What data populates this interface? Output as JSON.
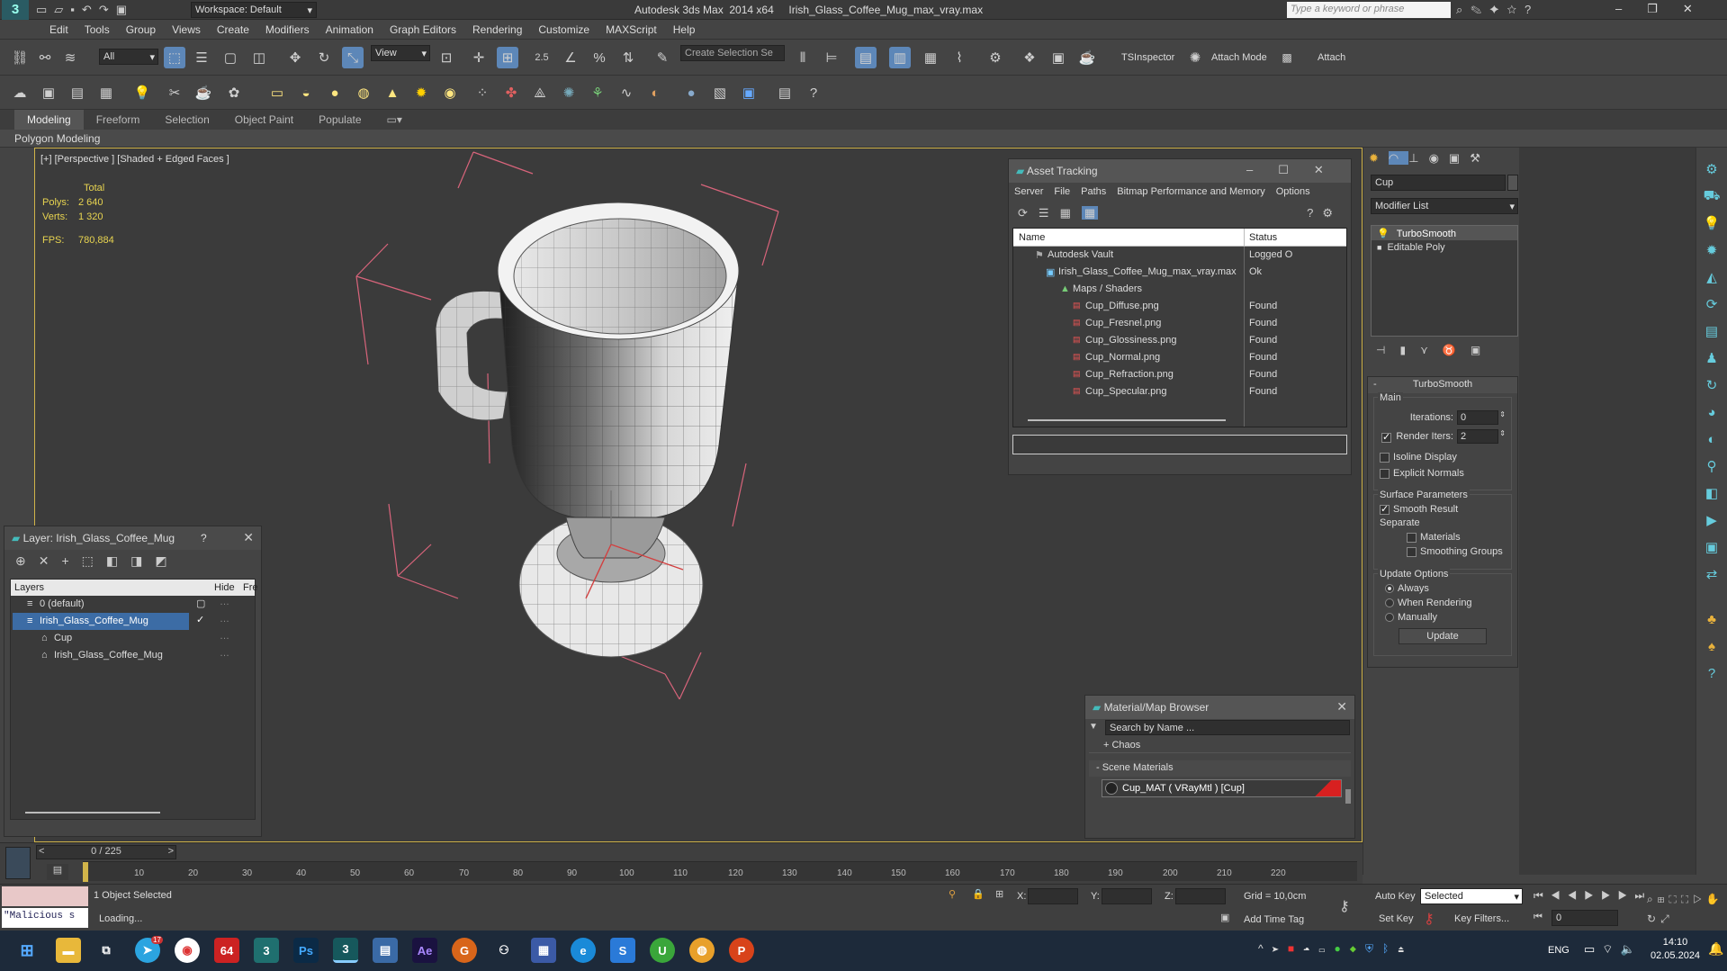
{
  "window": {
    "title": "Autodesk 3ds Max  2014 x64     Irish_Glass_Coffee_Mug_max_vray.max",
    "workspace": "Workspace: Default",
    "search_placeholder": "Type a keyword or phrase"
  },
  "menu": [
    "Edit",
    "Tools",
    "Group",
    "Views",
    "Create",
    "Modifiers",
    "Animation",
    "Graph Editors",
    "Rendering",
    "Customize",
    "MAXScript",
    "Help"
  ],
  "toolbar": {
    "filter_value": "All",
    "ref_coord": "View",
    "snap_label": "2.5",
    "selection_set_placeholder": "Create Selection Se",
    "tsinspector": "TSInspector",
    "attach_mode": "Attach Mode",
    "attach": "Attach"
  },
  "ribbon": {
    "tabs": [
      "Modeling",
      "Freeform",
      "Selection",
      "Object Paint",
      "Populate"
    ],
    "active": "Modeling",
    "sub": "Polygon Modeling"
  },
  "viewport": {
    "label": "[+] [Perspective ] [Shaded + Edged Faces ]",
    "stats_header": "Total",
    "polys_label": "Polys:",
    "polys_value": "2 640",
    "verts_label": "Verts:",
    "verts_value": "1 320",
    "fps_label": "FPS:",
    "fps_value": "780,884"
  },
  "layer_panel": {
    "title": "Layer: Irish_Glass_Coffee_Mug",
    "help": "?",
    "col_layers": "Layers",
    "col_hide": "Hide",
    "col_freeze": "Fre",
    "rows": [
      {
        "name": "0 (default)",
        "level": 1
      },
      {
        "name": "Irish_Glass_Coffee_Mug",
        "level": 1
      },
      {
        "name": "Cup",
        "level": 2
      },
      {
        "name": "Irish_Glass_Coffee_Mug",
        "level": 2
      }
    ]
  },
  "asset_tracking": {
    "title": "Asset Tracking",
    "menu": [
      "Server",
      "File",
      "Paths",
      "Bitmap Performance and Memory",
      "Options"
    ],
    "col_name": "Name",
    "col_status": "Status",
    "rows": [
      {
        "name": "Autodesk Vault",
        "status": "Logged O",
        "level": 1
      },
      {
        "name": "Irish_Glass_Coffee_Mug_max_vray.max",
        "status": "Ok",
        "level": 2
      },
      {
        "name": "Maps / Shaders",
        "status": "",
        "level": 3
      },
      {
        "name": "Cup_Diffuse.png",
        "status": "Found",
        "level": 4
      },
      {
        "name": "Cup_Fresnel.png",
        "status": "Found",
        "level": 4
      },
      {
        "name": "Cup_Glossiness.png",
        "status": "Found",
        "level": 4
      },
      {
        "name": "Cup_Normal.png",
        "status": "Found",
        "level": 4
      },
      {
        "name": "Cup_Refraction.png",
        "status": "Found",
        "level": 4
      },
      {
        "name": "Cup_Specular.png",
        "status": "Found",
        "level": 4
      }
    ]
  },
  "material_browser": {
    "title": "Material/Map Browser",
    "search_placeholder": "Search by Name ...",
    "group_chaos": "+ Chaos",
    "group_scene": "- Scene Materials",
    "material": "Cup_MAT  ( VRayMtl )  [Cup]"
  },
  "command_panel": {
    "object_name": "Cup",
    "modifier_list": "Modifier List",
    "stack": [
      "TurboSmooth",
      "Editable Poly"
    ],
    "rollout_title": "TurboSmooth",
    "main_label": "Main",
    "iterations_label": "Iterations:",
    "iterations_value": "0",
    "render_iters_label": "Render Iters:",
    "render_iters_value": "2",
    "isoline": "Isoline Display",
    "explicit_normals": "Explicit Normals",
    "surface_params": "Surface Parameters",
    "smooth_result": "Smooth Result",
    "separate": "Separate",
    "materials": "Materials",
    "smoothing_groups": "Smoothing Groups",
    "update_options": "Update Options",
    "always": "Always",
    "when_rendering": "When Rendering",
    "manually": "Manually",
    "update_btn": "Update"
  },
  "timeline": {
    "frame": "0 / 225",
    "ticks": [
      "10",
      "20",
      "30",
      "40",
      "50",
      "60",
      "70",
      "80",
      "90",
      "100",
      "110",
      "120",
      "130",
      "140",
      "150",
      "160",
      "170",
      "180",
      "190",
      "200",
      "210",
      "220"
    ]
  },
  "status": {
    "selected": "1 Object Selected",
    "loading": "Loading...",
    "script": "\"Malicious s",
    "x_label": "X:",
    "y_label": "Y:",
    "z_label": "Z:",
    "grid": "Grid = 10,0cm",
    "add_time_tag": "Add Time Tag",
    "auto_key": "Auto Key",
    "selected_dd": "Selected",
    "set_key": "Set Key",
    "key_filters": "Key Filters...",
    "frame_field": "0"
  },
  "taskbar": {
    "lang": "ENG",
    "time": "14:10",
    "date": "02.05.2024",
    "badge_64": "64",
    "chat_badge": "17"
  }
}
